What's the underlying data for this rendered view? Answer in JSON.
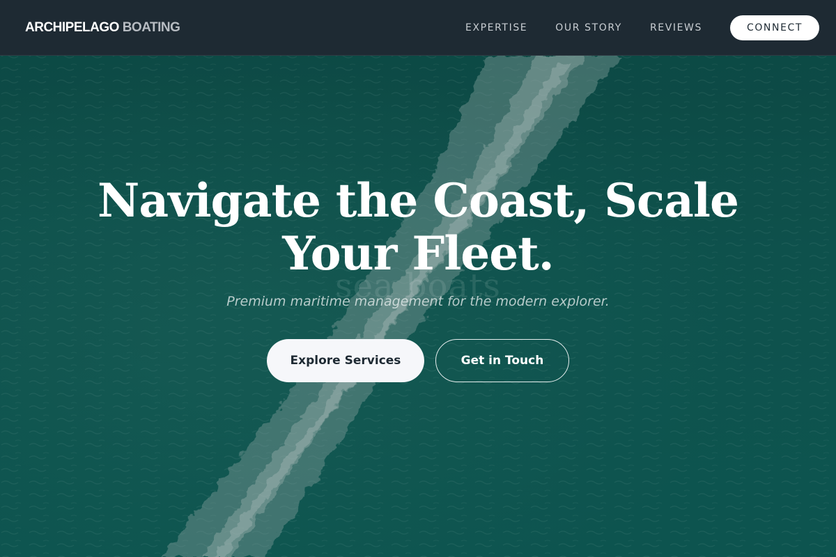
{
  "header": {
    "brand_primary": "ARCHIPELAGO",
    "brand_secondary": "BOATING",
    "nav": [
      {
        "label": "EXPERTISE"
      },
      {
        "label": "OUR STORY"
      },
      {
        "label": "REVIEWS"
      }
    ],
    "cta_label": "CONNECT"
  },
  "hero": {
    "title_line1": "Navigate the Coast, Scale",
    "title_line2": "Your Fleet.",
    "ghost_text": "sea boats",
    "subtitle": "Premium maritime management for the modern explorer.",
    "primary_button": "Explore Services",
    "secondary_button": "Get in Touch",
    "background_image": "aerial-ocean-boat-wake"
  },
  "colors": {
    "header_bg": "#1e2a33",
    "ocean": "#0f5650",
    "button_light": "#f6f7fa",
    "text_light": "#ffffff"
  }
}
